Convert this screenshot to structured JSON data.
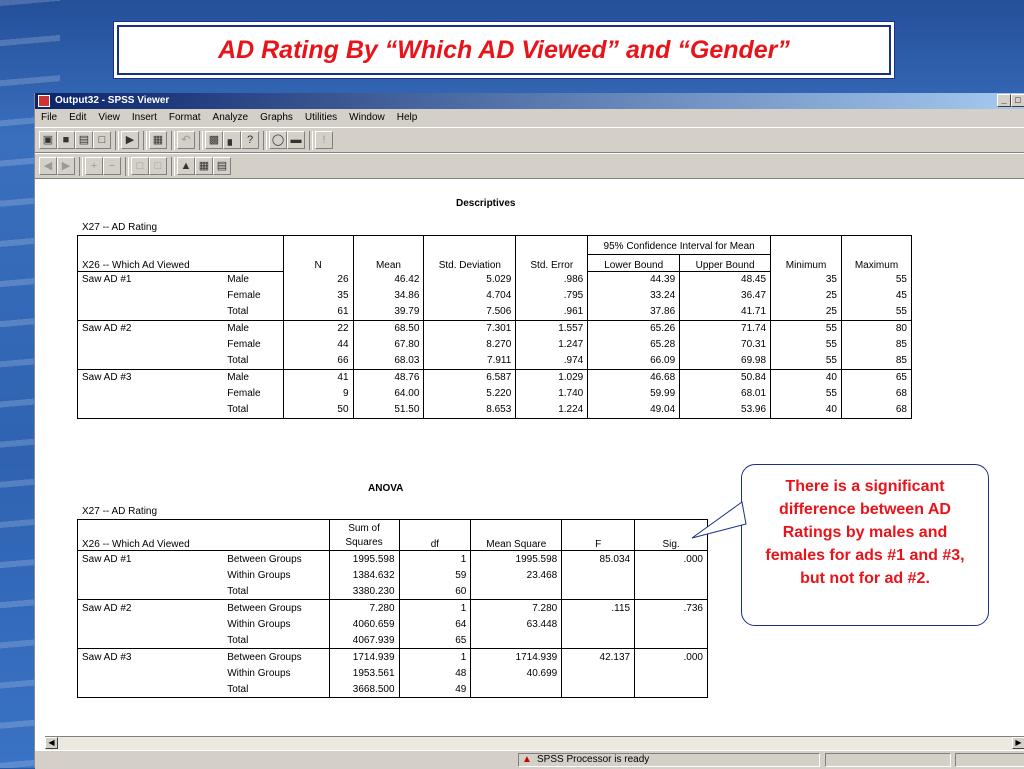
{
  "slide": {
    "title": "AD Rating By “Which AD Viewed” and “Gender”"
  },
  "window": {
    "title": "Output32 - SPSS Viewer",
    "controls": [
      "_",
      "□"
    ],
    "menu": [
      "File",
      "Edit",
      "View",
      "Insert",
      "Format",
      "Analyze",
      "Graphs",
      "Utilities",
      "Window",
      "Help"
    ],
    "status": "SPSS Processor  is ready"
  },
  "descriptives": {
    "heading": "Descriptives",
    "dependent": "X27 -- AD Rating",
    "factor_label": "X26 -- Which Ad Viewed",
    "ci_header": "95% Confidence Interval for Mean",
    "columns": [
      "N",
      "Mean",
      "Std. Deviation",
      "Std. Error",
      "Lower Bound",
      "Upper Bound",
      "Minimum",
      "Maximum"
    ],
    "rows": [
      {
        "group": "Saw AD #1",
        "gender": "Male",
        "n": "26",
        "mean": "46.42",
        "sd": "5.029",
        "se": ".986",
        "lb": "44.39",
        "ub": "48.45",
        "min": "35",
        "max": "55"
      },
      {
        "group": "",
        "gender": "Female",
        "n": "35",
        "mean": "34.86",
        "sd": "4.704",
        "se": ".795",
        "lb": "33.24",
        "ub": "36.47",
        "min": "25",
        "max": "45"
      },
      {
        "group": "",
        "gender": "Total",
        "n": "61",
        "mean": "39.79",
        "sd": "7.506",
        "se": ".961",
        "lb": "37.86",
        "ub": "41.71",
        "min": "25",
        "max": "55"
      },
      {
        "group": "Saw AD #2",
        "gender": "Male",
        "n": "22",
        "mean": "68.50",
        "sd": "7.301",
        "se": "1.557",
        "lb": "65.26",
        "ub": "71.74",
        "min": "55",
        "max": "80"
      },
      {
        "group": "",
        "gender": "Female",
        "n": "44",
        "mean": "67.80",
        "sd": "8.270",
        "se": "1.247",
        "lb": "65.28",
        "ub": "70.31",
        "min": "55",
        "max": "85"
      },
      {
        "group": "",
        "gender": "Total",
        "n": "66",
        "mean": "68.03",
        "sd": "7.911",
        "se": ".974",
        "lb": "66.09",
        "ub": "69.98",
        "min": "55",
        "max": "85"
      },
      {
        "group": "Saw AD #3",
        "gender": "Male",
        "n": "41",
        "mean": "48.76",
        "sd": "6.587",
        "se": "1.029",
        "lb": "46.68",
        "ub": "50.84",
        "min": "40",
        "max": "65"
      },
      {
        "group": "",
        "gender": "Female",
        "n": "9",
        "mean": "64.00",
        "sd": "5.220",
        "se": "1.740",
        "lb": "59.99",
        "ub": "68.01",
        "min": "55",
        "max": "68"
      },
      {
        "group": "",
        "gender": "Total",
        "n": "50",
        "mean": "51.50",
        "sd": "8.653",
        "se": "1.224",
        "lb": "49.04",
        "ub": "53.96",
        "min": "40",
        "max": "68"
      }
    ]
  },
  "anova": {
    "heading": "ANOVA",
    "dependent": "X27 -- AD Rating",
    "factor_label": "X26 -- Which Ad Viewed",
    "columns": [
      "Sum of Squares",
      "df",
      "Mean Square",
      "F",
      "Sig."
    ],
    "rows": [
      {
        "group": "Saw AD #1",
        "source": "Between Groups",
        "ss": "1995.598",
        "df": "1",
        "ms": "1995.598",
        "f": "85.034",
        "sig": ".000"
      },
      {
        "group": "",
        "source": "Within Groups",
        "ss": "1384.632",
        "df": "59",
        "ms": "23.468",
        "f": "",
        "sig": ""
      },
      {
        "group": "",
        "source": "Total",
        "ss": "3380.230",
        "df": "60",
        "ms": "",
        "f": "",
        "sig": ""
      },
      {
        "group": "Saw AD #2",
        "source": "Between Groups",
        "ss": "7.280",
        "df": "1",
        "ms": "7.280",
        "f": ".115",
        "sig": ".736"
      },
      {
        "group": "",
        "source": "Within Groups",
        "ss": "4060.659",
        "df": "64",
        "ms": "63.448",
        "f": "",
        "sig": ""
      },
      {
        "group": "",
        "source": "Total",
        "ss": "4067.939",
        "df": "65",
        "ms": "",
        "f": "",
        "sig": ""
      },
      {
        "group": "Saw AD #3",
        "source": "Between Groups",
        "ss": "1714.939",
        "df": "1",
        "ms": "1714.939",
        "f": "42.137",
        "sig": ".000"
      },
      {
        "group": "",
        "source": "Within Groups",
        "ss": "1953.561",
        "df": "48",
        "ms": "40.699",
        "f": "",
        "sig": ""
      },
      {
        "group": "",
        "source": "Total",
        "ss": "3668.500",
        "df": "49",
        "ms": "",
        "f": "",
        "sig": ""
      }
    ]
  },
  "callout": {
    "text": "There is a significant difference between AD Ratings by males and females for ads #1 and #3, but not for ad #2."
  },
  "colors": {
    "title_red": "#e8141a",
    "border_navy": "#1a2f8a",
    "titlebar": "#0a246a"
  }
}
